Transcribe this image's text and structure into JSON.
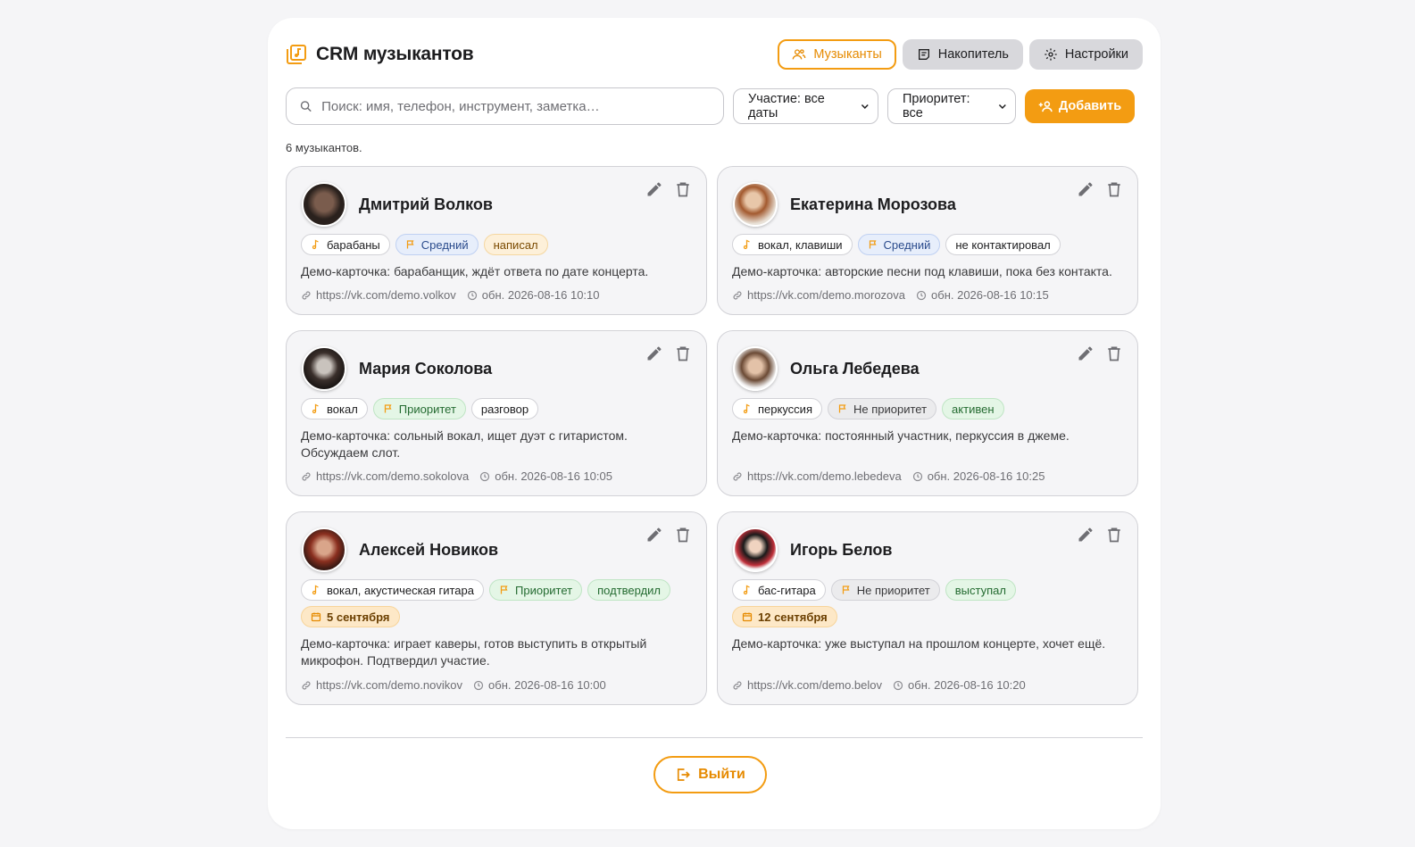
{
  "app": {
    "title": "CRM музыкантов",
    "accent": "#f39c12"
  },
  "nav": {
    "musicians": "Музыканты",
    "accumulator": "Накопитель",
    "settings": "Настройки"
  },
  "toolbar": {
    "search_placeholder": "Поиск: имя, телефон, инструмент, заметка…",
    "participation_filter": "Участие: все даты",
    "priority_filter": "Приоритет: все",
    "add_label": "Добавить"
  },
  "count_text": "6 музыкантов.",
  "cards": [
    {
      "name": "Дмитрий Волков",
      "instrument": "барабаны",
      "priority": "Средний",
      "status": "написал",
      "note": "Демо-карточка: барабанщик, ждёт ответа по дате концерта.",
      "link": "https://vk.com/demo.volkov",
      "updated": "обн. 2026-08-16 10:10"
    },
    {
      "name": "Екатерина Морозова",
      "instrument": "вокал, клавиши",
      "priority": "Средний",
      "status": "не контактировал",
      "note": "Демо-карточка: авторские песни под клавиши, пока без контакта.",
      "link": "https://vk.com/demo.morozova",
      "updated": "обн. 2026-08-16 10:15"
    },
    {
      "name": "Мария Соколова",
      "instrument": "вокал",
      "priority": "Приоритет",
      "status": "разговор",
      "note": "Демо-карточка: сольный вокал, ищет дуэт с гитаристом. Обсуждаем слот.",
      "link": "https://vk.com/demo.sokolova",
      "updated": "обн. 2026-08-16 10:05"
    },
    {
      "name": "Ольга Лебедева",
      "instrument": "перкуссия",
      "priority": "Не приоритет",
      "status": "активен",
      "note": "Демо-карточка: постоянный участник, перкуссия в джеме.",
      "link": "https://vk.com/demo.lebedeva",
      "updated": "обн. 2026-08-16 10:25"
    },
    {
      "name": "Алексей Новиков",
      "instrument": "вокал, акустическая гитара",
      "priority": "Приоритет",
      "status": "подтвердил",
      "date": "5 сентября",
      "note": "Демо-карточка: играет каверы, готов выступить в открытый микрофон. Подтвердил участие.",
      "link": "https://vk.com/demo.novikov",
      "updated": "обн. 2026-08-16 10:00"
    },
    {
      "name": "Игорь Белов",
      "instrument": "бас-гитара",
      "priority": "Не приоритет",
      "status": "выступал",
      "date": "12 сентября",
      "note": "Демо-карточка: уже выступал на прошлом концерте, хочет ещё.",
      "link": "https://vk.com/demo.belov",
      "updated": "обн. 2026-08-16 10:20"
    }
  ],
  "logout_label": "Выйти"
}
